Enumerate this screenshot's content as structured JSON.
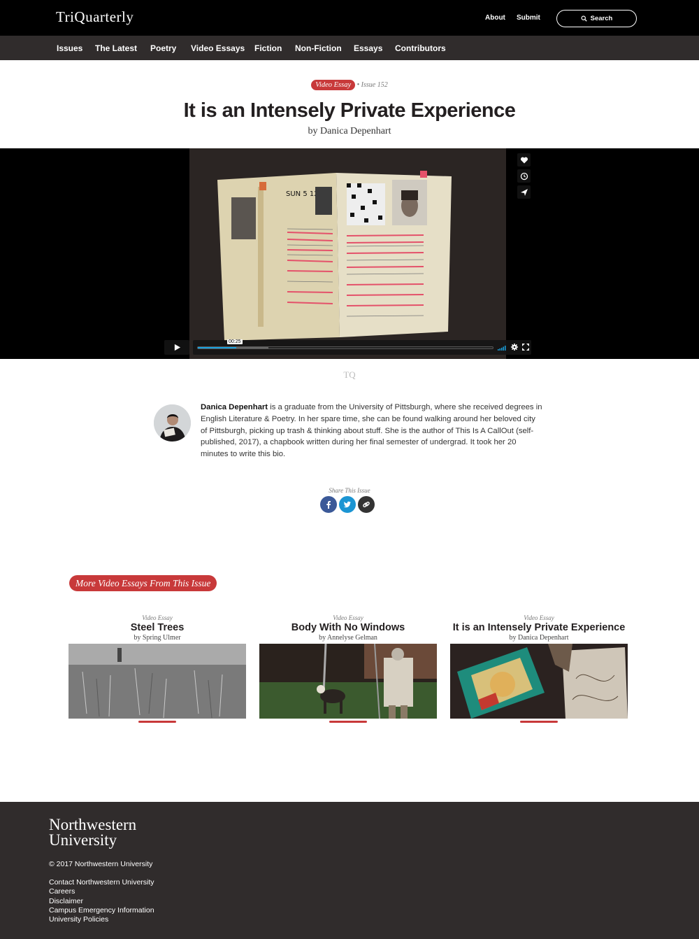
{
  "header": {
    "logo": "TriQuarterly",
    "links": {
      "about": "About",
      "submit": "Submit"
    },
    "search_label": "Search"
  },
  "nav": [
    "Issues",
    "The Latest",
    "Poetry",
    "Video Essays",
    "Fiction",
    "Non-Fiction",
    "Essays",
    "Contributors"
  ],
  "article": {
    "category": "Video Essay",
    "issue": "• Issue 152",
    "title": "It is an Intensely Private Experience",
    "byline": "by Danica Depenhart"
  },
  "video": {
    "current_time": "00:25",
    "progress": 0.13,
    "buffered": 0.24
  },
  "tq_mark": "TQ",
  "bio": {
    "name": "Danica Depenhart",
    "text": " is a graduate from the University of Pittsburgh, where she received degrees in English Literature & Poetry.  In her spare time, she can be found walking around her beloved city of Pittsburgh, picking up trash & thinking about stuff. She is the author of This Is A CallOut (self-published, 2017), a chapbook written during her final semester of undergrad. It took her 20 minutes to write this bio."
  },
  "share": {
    "label": "Share This Issue",
    "colors": {
      "facebook": "#3b5998",
      "twitter": "#1b95d3",
      "link": "#333333"
    }
  },
  "more": {
    "heading": "More Video Essays From This Issue",
    "cards": [
      {
        "type": "Video Essay",
        "title": "Steel Trees",
        "author": "by Spring Ulmer"
      },
      {
        "type": "Video Essay",
        "title": "Body With No Windows",
        "author": "by Annelyse Gelman"
      },
      {
        "type": "Video Essay",
        "title": "It is an Intensely Private Experience",
        "author": "by Danica Depenhart"
      }
    ]
  },
  "footer": {
    "logo_line1": "Northwestern",
    "logo_line2": "University",
    "copyright": "© 2017 Northwestern University",
    "links": [
      "Contact Northwestern University",
      "Careers",
      "Disclaimer",
      "Campus Emergency Information",
      "University Policies"
    ]
  },
  "colors": {
    "accent": "#c8393a",
    "nav_bg": "#302c2c",
    "progress": "#1aa2e0"
  }
}
